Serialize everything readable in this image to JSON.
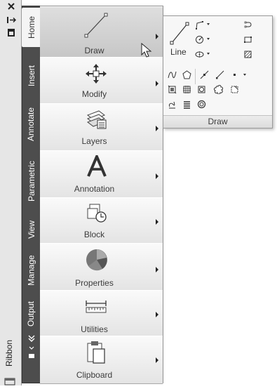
{
  "frame": {
    "ribbon_label": "Ribbon"
  },
  "tabs": [
    {
      "label": "Home",
      "active": true
    },
    {
      "label": "Insert",
      "active": false
    },
    {
      "label": "Annotate",
      "active": false
    },
    {
      "label": "Parametric",
      "active": false
    },
    {
      "label": "View",
      "active": false
    },
    {
      "label": "Manage",
      "active": false
    },
    {
      "label": "Output",
      "active": false
    }
  ],
  "panels": [
    {
      "label": "Draw",
      "icon": "line-icon",
      "active": true
    },
    {
      "label": "Modify",
      "icon": "move-icon",
      "active": false
    },
    {
      "label": "Layers",
      "icon": "layers-icon",
      "active": false
    },
    {
      "label": "Annotation",
      "icon": "text-icon",
      "active": false
    },
    {
      "label": "Block",
      "icon": "block-icon",
      "active": false
    },
    {
      "label": "Properties",
      "icon": "properties-icon",
      "active": false
    },
    {
      "label": "Utilities",
      "icon": "measure-icon",
      "active": false
    },
    {
      "label": "Clipboard",
      "icon": "clipboard-icon",
      "active": false
    }
  ],
  "flyout": {
    "title": "Draw",
    "line_label": "Line"
  }
}
